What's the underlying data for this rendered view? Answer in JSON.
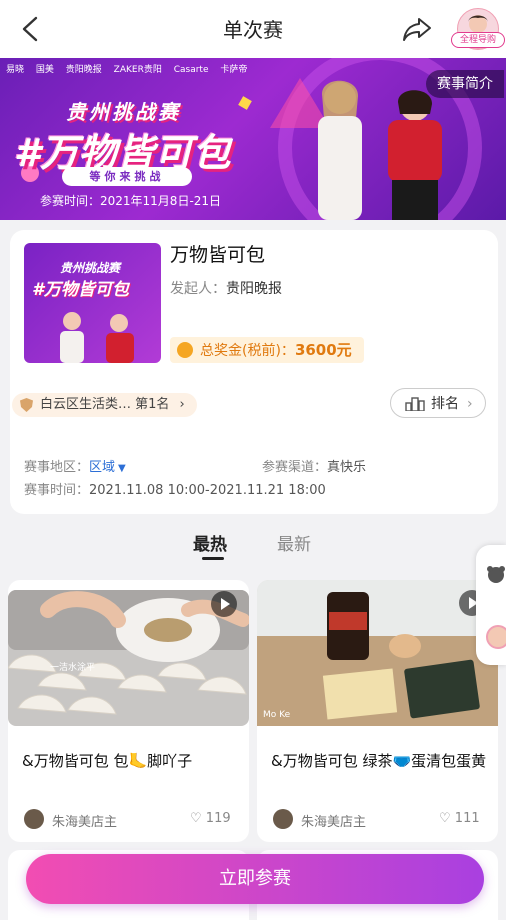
{
  "header": {
    "title": "单次赛",
    "guide_label": "全程导购"
  },
  "banner": {
    "sponsors": [
      "易晓",
      "国美",
      "贵阳晚报",
      "ZAKER贵阳",
      "Casarte",
      "卡萨帝"
    ],
    "intro_label": "赛事简介",
    "line1": "贵州挑战赛",
    "line2": "#万物皆可包",
    "pill": "等你来挑战",
    "time": "参赛时间：2021年11月8日-21日"
  },
  "contest": {
    "thumb_line1": "贵州挑战赛",
    "thumb_line2": "#万物皆可包",
    "title": "万物皆可包",
    "organizer_label": "发起人：",
    "organizer": "贵阳晚报",
    "prize_label": "总奖金(税前)：",
    "prize_amount": "3600元",
    "rank_text": "白云区生活类… 第1名",
    "rank_button": "排名",
    "region_label": "赛事地区：",
    "region_value": "区域",
    "channel_label": "参赛渠道：",
    "channel_value": "真快乐",
    "time_label": "赛事时间：",
    "time_value": "2021.11.08 10:00-2021.11.21 18:00"
  },
  "tabs": [
    {
      "label": "最热",
      "active": true
    },
    {
      "label": "最新",
      "active": false
    }
  ],
  "feed": [
    {
      "title": "&万物皆可包 包🦶脚吖子",
      "user": "朱海美店主",
      "likes": "119",
      "image_caption": "一洁水涂平"
    },
    {
      "title": "&万物皆可包 绿茶🩲蛋清包蛋黄",
      "user": "朱海美店主",
      "likes": "111",
      "image_caption": "Mo Ke"
    }
  ],
  "cta_label": "立即参赛",
  "colors": {
    "accent": "#e23b8e",
    "prize": "#e07a10",
    "link": "#2d6fd6",
    "banner": "#7a22c4"
  }
}
